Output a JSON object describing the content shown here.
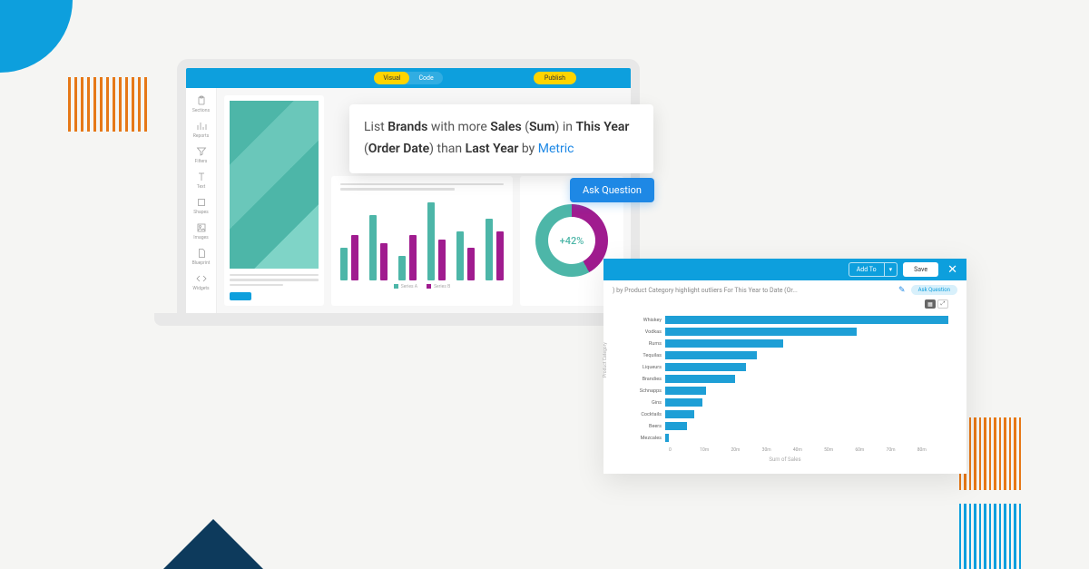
{
  "colors": {
    "primary": "#0d9fdd",
    "accent_yellow": "#ffd400",
    "teal": "#4db6a8",
    "magenta": "#a01c8f",
    "blue_btn": "#1e88e5"
  },
  "laptop": {
    "tabs": {
      "visual": "Visual",
      "code": "Code"
    },
    "publish": "Publish",
    "sidebar": [
      {
        "label": "Sections",
        "icon": "clipboard"
      },
      {
        "label": "Reports",
        "icon": "bar-chart"
      },
      {
        "label": "Filters",
        "icon": "funnel"
      },
      {
        "label": "Text",
        "icon": "text-t"
      },
      {
        "label": "Shapes",
        "icon": "square"
      },
      {
        "label": "Images",
        "icon": "image"
      },
      {
        "label": "Blueprint",
        "icon": "doc"
      },
      {
        "label": "Widgets",
        "icon": "code"
      }
    ],
    "donut_value": "+42%"
  },
  "chart_data": [
    {
      "type": "bar",
      "series": [
        {
          "name": "Series A",
          "color": "#4db6a8",
          "values": [
            40,
            80,
            30,
            95,
            60,
            75
          ]
        },
        {
          "name": "Series B",
          "color": "#a01c8f",
          "values": [
            55,
            45,
            55,
            50,
            40,
            60
          ]
        }
      ],
      "legend": [
        "Series A",
        "Series B"
      ]
    },
    {
      "type": "pie",
      "title": "+42%",
      "values": [
        {
          "label": "magenta",
          "pct": 42
        },
        {
          "label": "teal",
          "pct": 58
        }
      ]
    },
    {
      "type": "bar",
      "orientation": "horizontal",
      "ylabel": "Product Category",
      "xlabel": "Sum of Sales",
      "xticks": [
        "0",
        "10m",
        "20m",
        "30m",
        "40m",
        "50m",
        "60m",
        "70m",
        "80m"
      ],
      "categories": [
        "Whiskey",
        "Vodkas",
        "Rums",
        "Tequilas",
        "Liqueurs",
        "Brandies",
        "Schnapps",
        "Gins",
        "Cocktails",
        "Beers",
        "Mezcales"
      ],
      "values": [
        77,
        52,
        32,
        25,
        22,
        19,
        11,
        10,
        8,
        6,
        1
      ]
    }
  ],
  "query": {
    "text_pre": "List ",
    "brands": "Brands",
    "mid1": " with more ",
    "sales": "Sales",
    "paren1": " (",
    "sum": "Sum",
    "paren1c": ") in ",
    "this_year": "This Year",
    "paren2": " (",
    "order_date": "Order Date",
    "paren2c": ") than ",
    "last_year": "Last Year",
    "by": " by ",
    "metric": "Metric"
  },
  "ask_question": "Ask Question",
  "win2": {
    "add_to": "Add To",
    "save": "Save",
    "subtitle": ") by Product Category highlight outliers For This Year to Date (Or...",
    "ask_pill": "Ask Question"
  }
}
